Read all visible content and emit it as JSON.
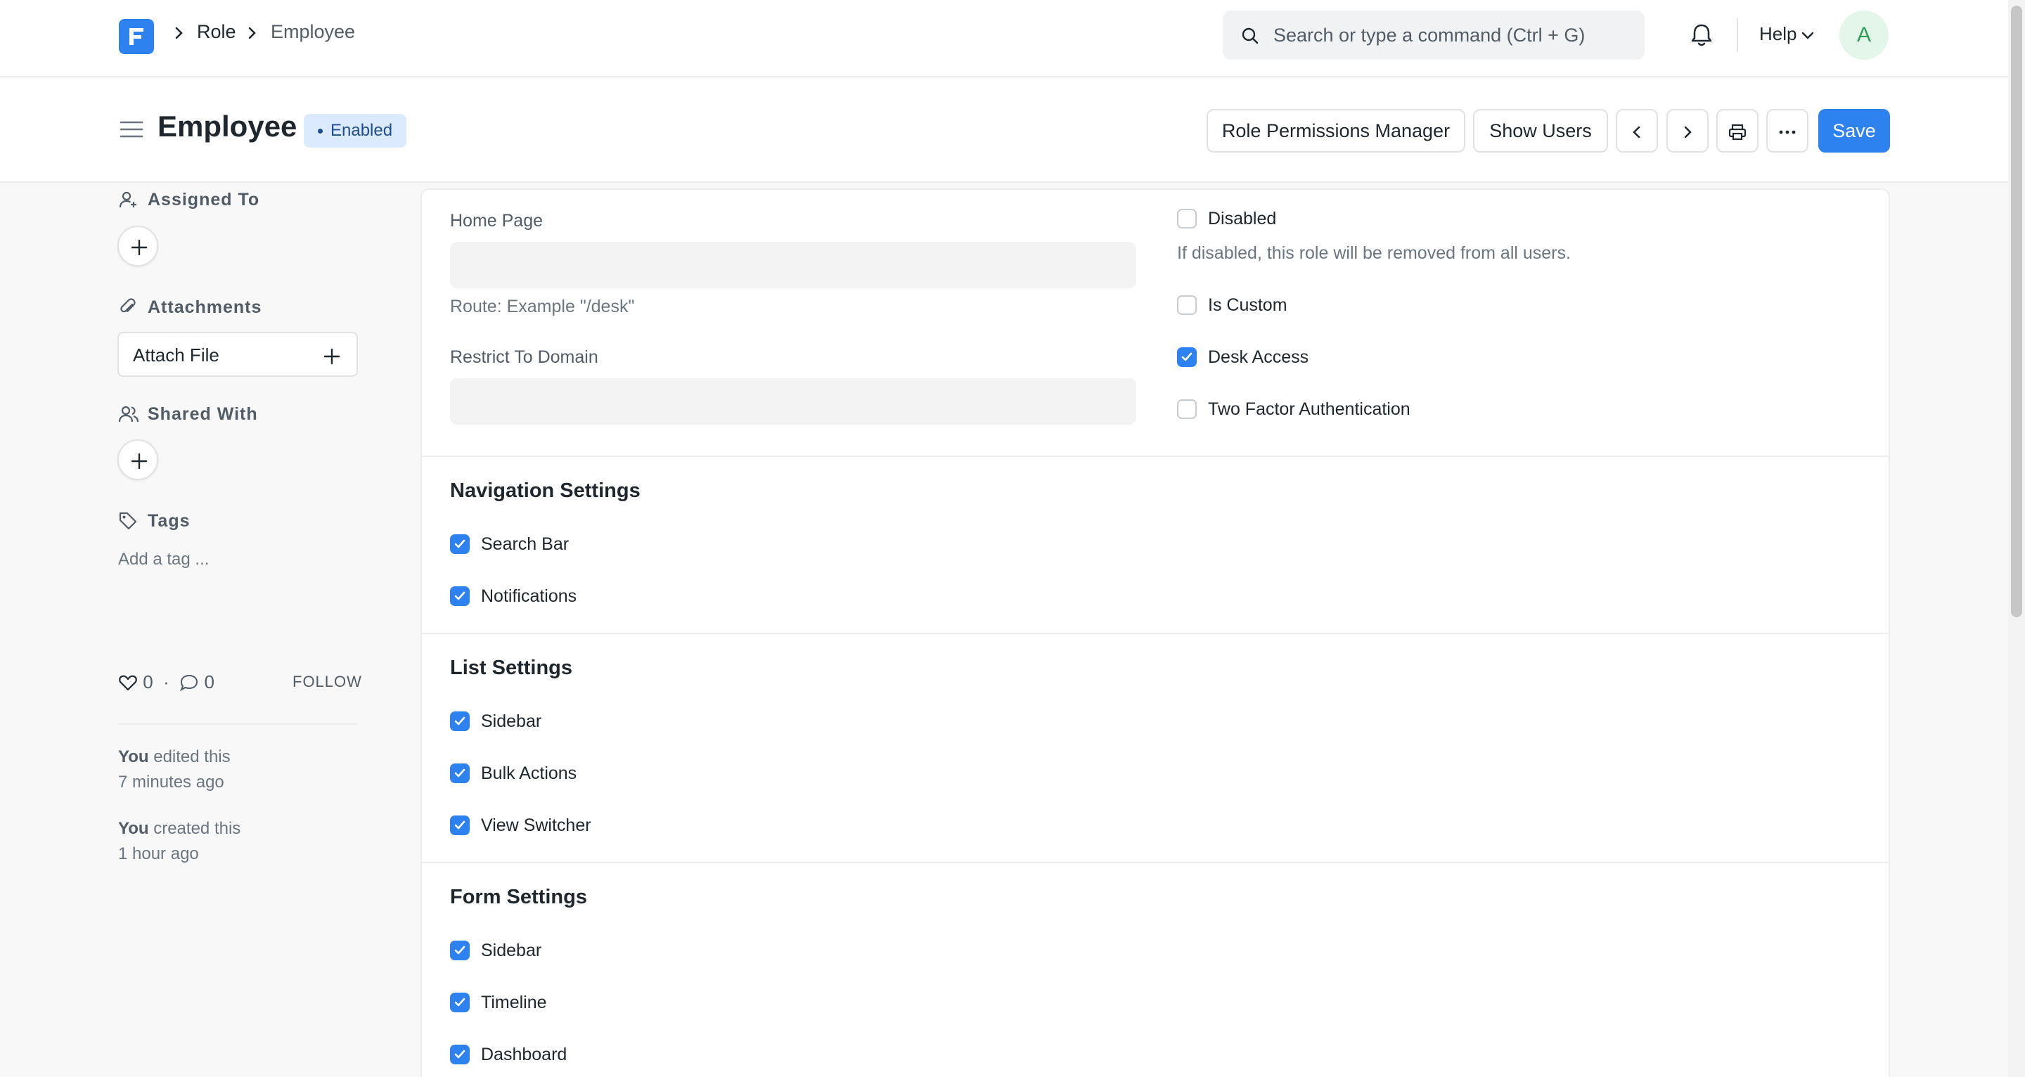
{
  "navbar": {
    "breadcrumbs": [
      "Role",
      "Employee"
    ],
    "search_placeholder": "Search or type a command (Ctrl + G)",
    "help_label": "Help",
    "avatar_initial": "A"
  },
  "header": {
    "title": "Employee",
    "status": "Enabled",
    "buttons": {
      "role_permissions": "Role Permissions Manager",
      "show_users": "Show Users",
      "save": "Save"
    }
  },
  "sidebar": {
    "assigned_to": "Assigned To",
    "attachments": "Attachments",
    "attach_file": "Attach File",
    "shared_with": "Shared With",
    "tags": "Tags",
    "add_tag": "Add a tag ...",
    "likes": "0",
    "comments": "0",
    "follow": "FOLLOW",
    "activity": [
      {
        "who": "You",
        "what": "edited this",
        "when": "7 minutes ago"
      },
      {
        "who": "You",
        "what": "created this",
        "when": "1 hour ago"
      }
    ]
  },
  "form": {
    "home_page": {
      "label": "Home Page",
      "value": "",
      "help": "Route: Example \"/desk\""
    },
    "restrict_domain": {
      "label": "Restrict To Domain",
      "value": ""
    },
    "disabled": {
      "label": "Disabled",
      "checked": false,
      "help": "If disabled, this role will be removed from all users."
    },
    "is_custom": {
      "label": "Is Custom",
      "checked": false
    },
    "desk_access": {
      "label": "Desk Access",
      "checked": true
    },
    "two_factor": {
      "label": "Two Factor Authentication",
      "checked": false
    },
    "sections": [
      {
        "title": "Navigation Settings",
        "items": [
          {
            "label": "Search Bar",
            "checked": true
          },
          {
            "label": "Notifications",
            "checked": true
          }
        ]
      },
      {
        "title": "List Settings",
        "items": [
          {
            "label": "Sidebar",
            "checked": true
          },
          {
            "label": "Bulk Actions",
            "checked": true
          },
          {
            "label": "View Switcher",
            "checked": true
          }
        ]
      },
      {
        "title": "Form Settings",
        "items": [
          {
            "label": "Sidebar",
            "checked": true
          },
          {
            "label": "Timeline",
            "checked": true
          },
          {
            "label": "Dashboard",
            "checked": true
          }
        ]
      }
    ]
  },
  "colors": {
    "accent": "#2d82f0",
    "status_bg": "#dbeafe",
    "status_text": "#1e4e91"
  },
  "icons": [
    "app-logo-icon",
    "chevron-right-icon",
    "search-icon",
    "bell-icon",
    "chevron-down-icon",
    "hamburger-icon",
    "chevron-left-icon",
    "printer-icon",
    "ellipsis-icon",
    "user-plus-icon",
    "paperclip-icon",
    "users-icon",
    "tag-icon",
    "heart-icon",
    "comment-icon",
    "plus-icon",
    "check-icon"
  ]
}
